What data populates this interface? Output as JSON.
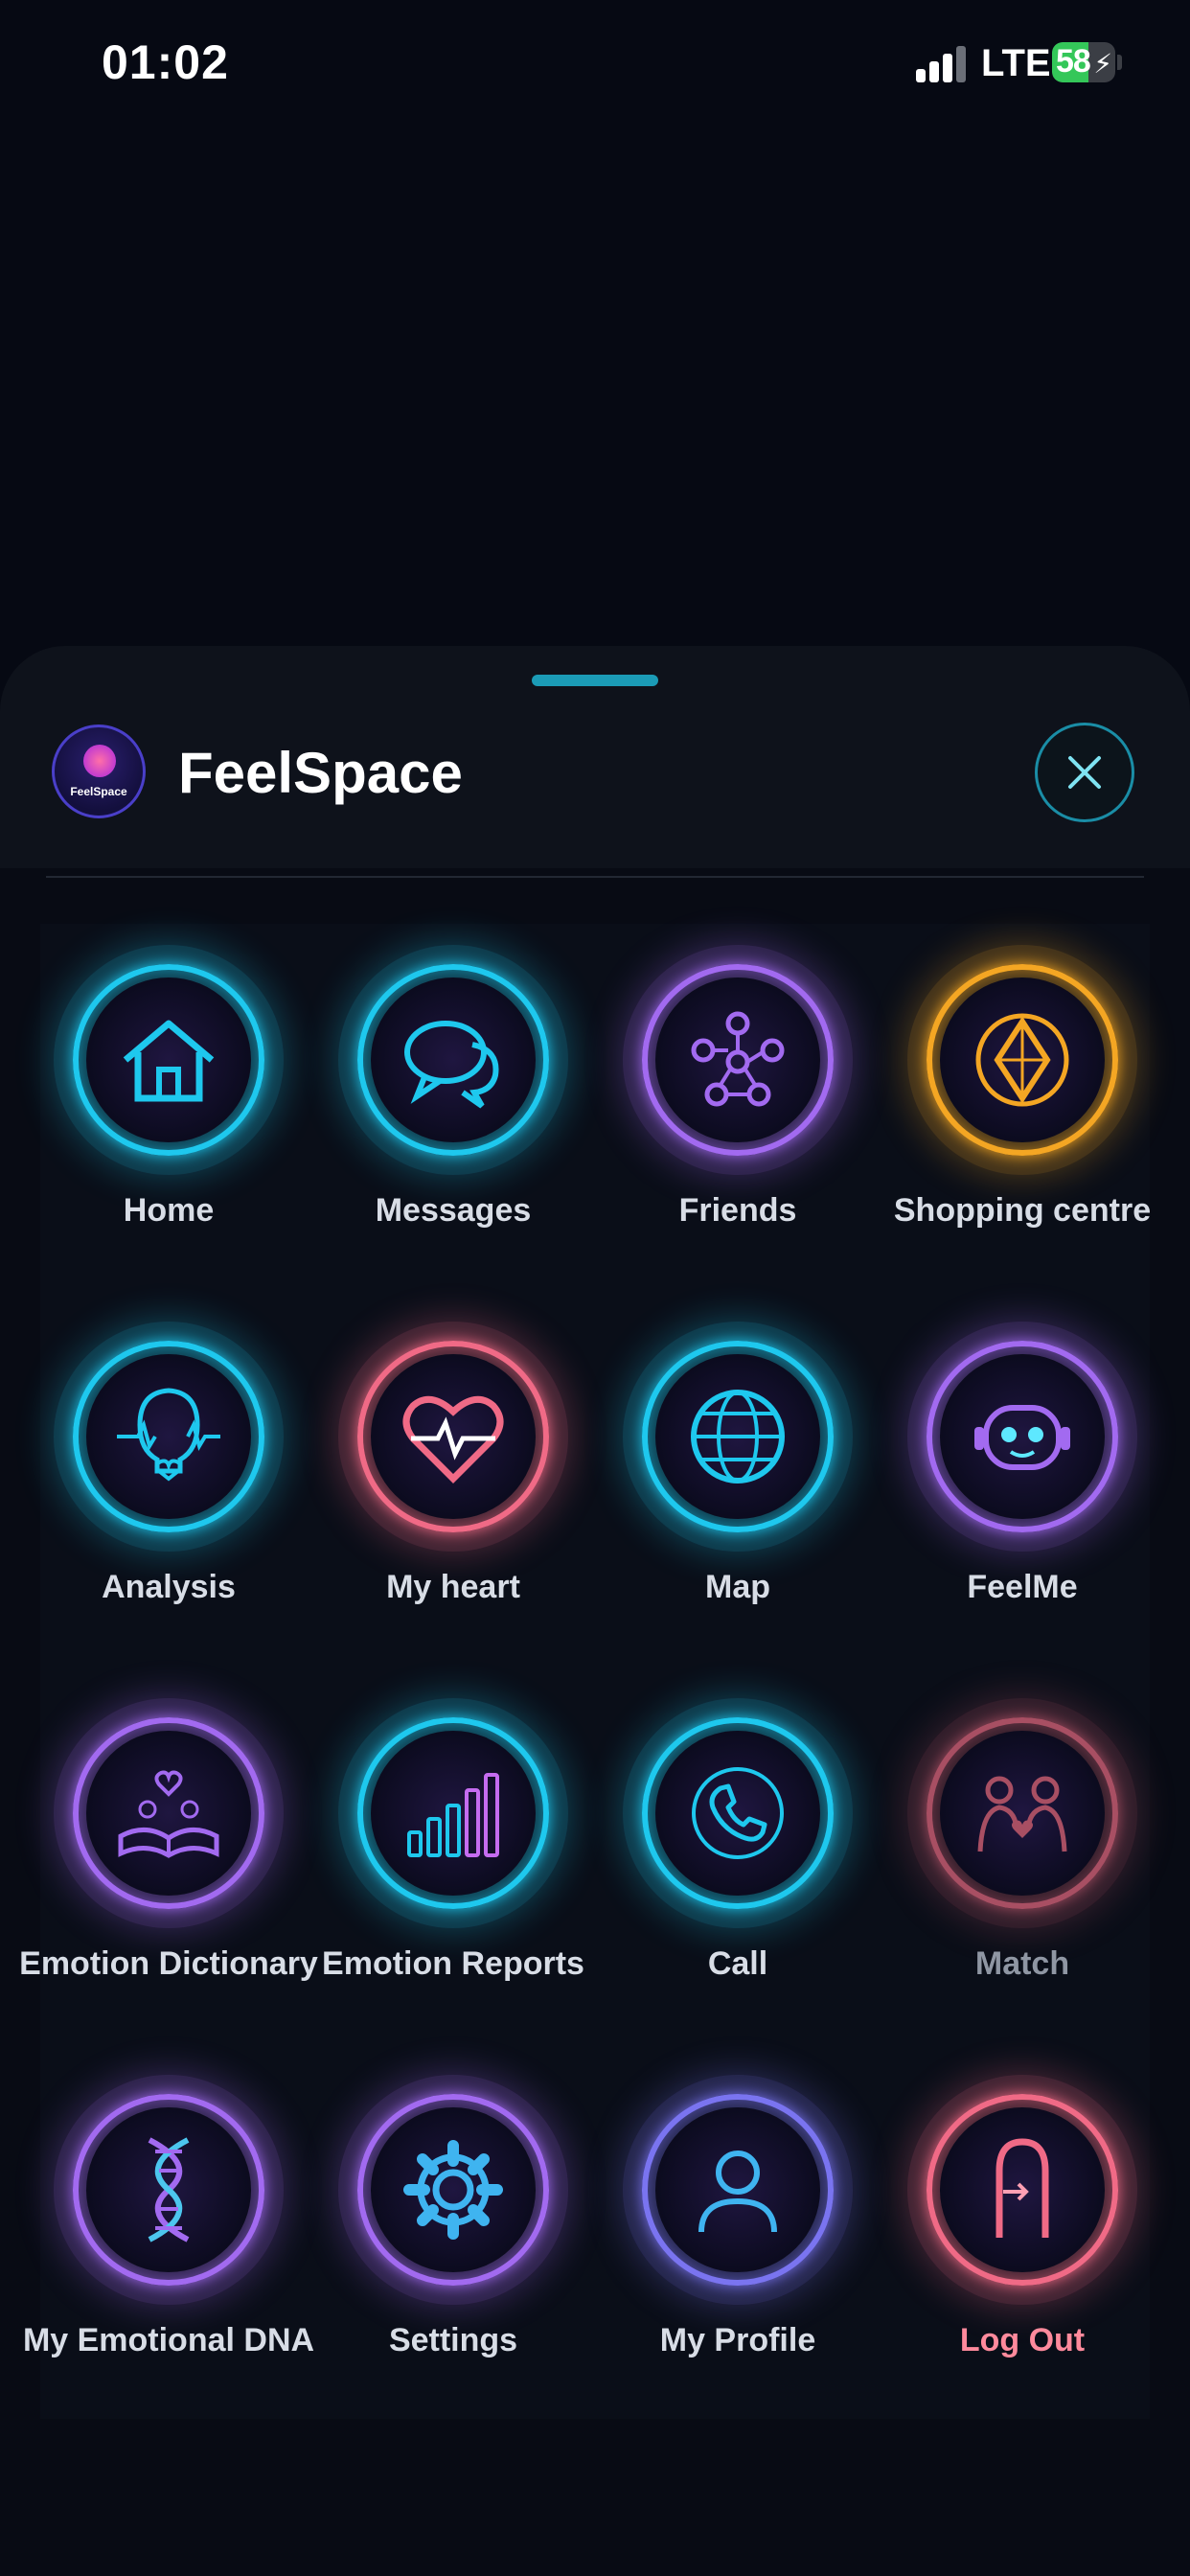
{
  "status_bar": {
    "time": "01:02",
    "network": "LTE",
    "battery": "58",
    "battery_level": 0.58
  },
  "header": {
    "logo_text": "FeelSpace",
    "title": "FeelSpace"
  },
  "menu": [
    {
      "label": "Home",
      "icon": "home-icon",
      "color": "#1ec8ee"
    },
    {
      "label": "Messages",
      "icon": "chat-bubbles-icon",
      "color": "#1ec8ee"
    },
    {
      "label": "Friends",
      "icon": "network-people-icon",
      "color": "#a26af0"
    },
    {
      "label": "Shopping centre",
      "icon": "diamond-emblem-icon",
      "color": "#f4a623"
    },
    {
      "label": "Analysis",
      "icon": "head-profile-icon",
      "color": "#1ec8ee"
    },
    {
      "label": "My heart",
      "icon": "heartbeat-icon",
      "color": "#f06a86"
    },
    {
      "label": "Map",
      "icon": "globe-icon",
      "color": "#1ec8ee"
    },
    {
      "label": "FeelMe",
      "icon": "robot-face-icon",
      "color": "#a26af0"
    },
    {
      "label": "Emotion Dictionary",
      "icon": "open-book-icon",
      "color": "#a26af0"
    },
    {
      "label": "Emotion Reports",
      "icon": "bar-chart-icon",
      "color": "#1ec8ee"
    },
    {
      "label": "Call",
      "icon": "phone-icon",
      "color": "#1ec8ee"
    },
    {
      "label": "Match",
      "icon": "couple-heart-icon",
      "color": "#a84f63"
    },
    {
      "label": "My Emotional DNA",
      "icon": "dna-icon",
      "color": "#a26af0"
    },
    {
      "label": "Settings",
      "icon": "gear-icon",
      "color": "#a26af0"
    },
    {
      "label": "My Profile",
      "icon": "user-icon",
      "color": "#7a74f0"
    },
    {
      "label": "Log Out",
      "icon": "door-exit-icon",
      "color": "#f06a86"
    }
  ]
}
